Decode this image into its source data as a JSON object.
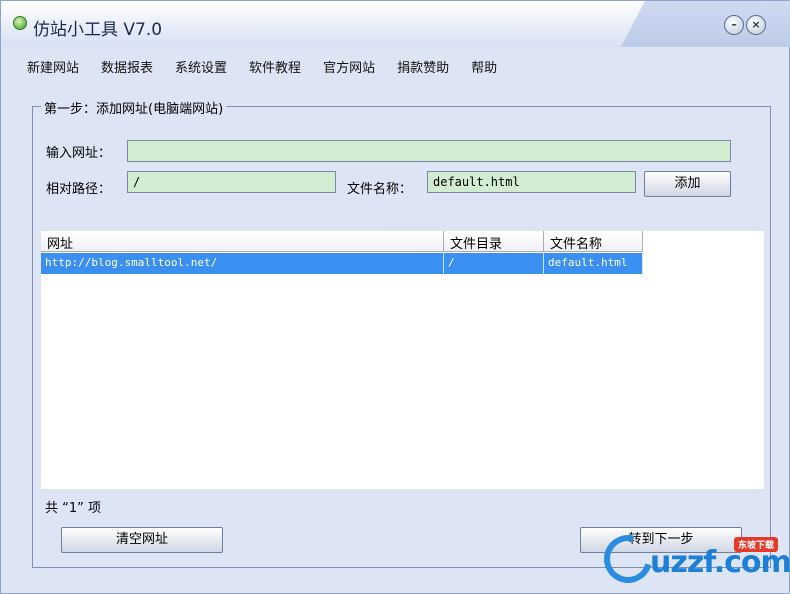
{
  "window": {
    "title": "仿站小工具 V7.0",
    "min_glyph": "–",
    "close_glyph": "×"
  },
  "menu": [
    "新建网站",
    "数据报表",
    "系统设置",
    "软件教程",
    "官方网站",
    "捐款赞助",
    "帮助"
  ],
  "step": {
    "caption": "第一步：添加网址(电脑端网站)",
    "url_label": "输入网址：",
    "url_value": "",
    "path_label": "相对路径：",
    "path_value": "/",
    "filename_label": "文件名称：",
    "filename_value": "default.html",
    "add_button": "添加"
  },
  "table": {
    "columns": [
      "网址",
      "文件目录",
      "文件名称"
    ],
    "rows": [
      {
        "url": "http://blog.smalltool.net/",
        "dir": "/",
        "file": "default.html",
        "selected": true
      }
    ]
  },
  "count_text": "共 “1” 项",
  "buttons": {
    "clear": "清空网址",
    "next": "转到下一步"
  },
  "watermark": {
    "text": "uzzf.com",
    "badge": "东坡下载"
  },
  "colors": {
    "field_bg": "#d1ecd1",
    "selection": "#3a8ff0",
    "window_bg": "#dde5f5"
  }
}
